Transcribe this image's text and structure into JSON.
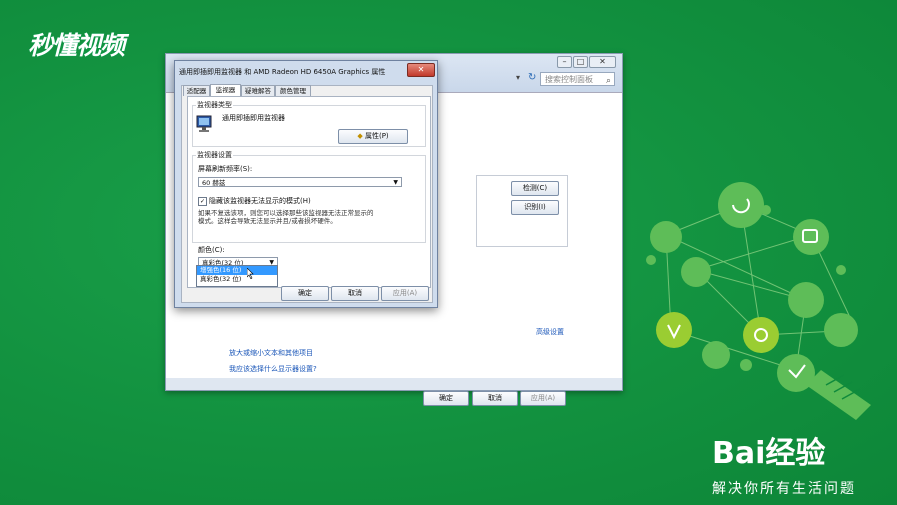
{
  "watermark": {
    "logo": "秒懂视频"
  },
  "baidu": {
    "title": "Bai经验",
    "slogan": "解决你所有生活问题"
  },
  "back_window": {
    "search_placeholder": "搜索控制面板",
    "buttons": {
      "detect": "检测(C)",
      "identify": "识别(I)",
      "ok": "确定",
      "cancel": "取消",
      "apply": "应用(A)"
    },
    "links": {
      "advanced": "高级设置",
      "make_text_larger": "放大或缩小文本和其他项目",
      "what_settings": "我应该选择什么显示器设置?"
    }
  },
  "dialog": {
    "title": "通用即插即用监视器 和 AMD Radeon HD 6450A Graphics 属性",
    "close": "✕",
    "tabs": [
      "适配器",
      "监视器",
      "疑难解答",
      "颜色管理"
    ],
    "active_tab": 1,
    "monitor_type_group": "监视器类型",
    "monitor_name": "通用即插即用监视器",
    "properties_button": "属性(P)",
    "monitor_settings_group": "监视器设置",
    "refresh_label": "屏幕刷新频率(S):",
    "refresh_value": "60 赫兹",
    "hide_modes_label": "隐藏该监视器无法显示的模式(H)",
    "hide_modes_checked": true,
    "hide_modes_desc_1": "如果不复选该项，则您可以选择那些该监视器无法正常显示的",
    "hide_modes_desc_2": "模式。这样会导致无法显示并且/或者损坏硬件。",
    "colors_label": "颜色(C):",
    "colors_value": "真彩色(32 位)",
    "colors_options": [
      "增强色(16 位)",
      "真彩色(32 位)"
    ],
    "colors_highlighted": 0,
    "ok": "确定",
    "cancel": "取消",
    "apply": "应用(A)"
  },
  "colors": {
    "background": "#14903f",
    "highlight": "#3399ff",
    "link": "#1a56b8"
  }
}
